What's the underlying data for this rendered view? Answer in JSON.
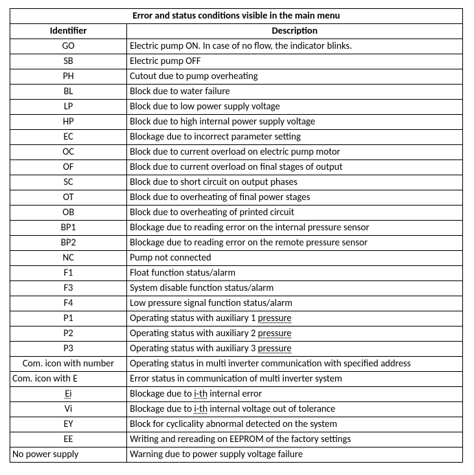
{
  "table": {
    "title": "Error and status conditions visible in the main menu",
    "headers": {
      "id": "Identifier",
      "desc": "Description"
    },
    "rows": [
      {
        "align": "center",
        "id": "GO",
        "desc": "Electric pump ON.   In case of no flow, the indicator blinks."
      },
      {
        "align": "center",
        "id": "SB",
        "desc": "Electric pump OFF"
      },
      {
        "align": "center",
        "id": "PH",
        "desc": "Cutout due to pump overheating"
      },
      {
        "align": "center",
        "id": "BL",
        "desc": "Block due to water failure"
      },
      {
        "align": "center",
        "id": "LP",
        "desc": "Block due to low power supply voltage"
      },
      {
        "align": "center",
        "id": "HP",
        "desc": "Block due to high internal power supply voltage"
      },
      {
        "align": "center",
        "id": "EC",
        "desc": "Blockage due to incorrect parameter setting"
      },
      {
        "align": "center",
        "id": "OC",
        "desc": "Block due to current overload on electric pump motor"
      },
      {
        "align": "center",
        "id": "OF",
        "desc": "Block due to current overload on final stages of output"
      },
      {
        "align": "center",
        "id": "SC",
        "desc": "Block due to short circuit on output phases"
      },
      {
        "align": "center",
        "id": "OT",
        "desc": "Block due to overheating of final power stages"
      },
      {
        "align": "center",
        "id": "OB",
        "desc": "Block due to overheating of printed circuit"
      },
      {
        "align": "center",
        "id": "BP1",
        "desc": "Blockage due to reading error on the internal pressure sensor"
      },
      {
        "align": "center",
        "id": "BP2",
        "desc": "Blockage due to reading error on the remote pressure sensor"
      },
      {
        "align": "center",
        "id": "NC",
        "desc": "Pump not connected"
      },
      {
        "align": "center",
        "id": "F1",
        "desc": "Float function status/alarm"
      },
      {
        "align": "center",
        "id": "F3",
        "desc": "System disable function status/alarm"
      },
      {
        "align": "center",
        "id": "F4",
        "desc": "Low pressure signal function status/alarm"
      },
      {
        "align": "center",
        "id": "P1",
        "desc_parts": [
          "Operating status with auxiliary 1 ",
          {
            "u": "pressure"
          }
        ]
      },
      {
        "align": "center",
        "id": "P2",
        "desc_parts": [
          "Operating status with auxiliary 2 ",
          {
            "u": "pressure"
          }
        ]
      },
      {
        "align": "center",
        "id": "P3",
        "desc_parts": [
          "Operating status with auxiliary 3 ",
          {
            "u": "pressure"
          }
        ]
      },
      {
        "align": "center",
        "id": "Com. icon with number",
        "desc": "Operating status in multi inverter communication with specified address"
      },
      {
        "align": "left",
        "id": "Com. icon with E",
        "desc": "Error status in communication of multi inverter system"
      },
      {
        "align": "center",
        "id_parts": [
          {
            "u": "Ei"
          }
        ],
        "desc_parts": [
          "Blockage due to ",
          {
            "u": "i-th"
          },
          " internal error"
        ]
      },
      {
        "align": "center",
        "id": "Vi",
        "desc_parts": [
          "Blockage due to ",
          {
            "u": "i-th"
          },
          " internal voltage out of tolerance"
        ]
      },
      {
        "align": "center",
        "id": "EY",
        "desc": "Block for cyclicality abnormal detected on the system"
      },
      {
        "align": "center",
        "id": "EE",
        "desc": "Writing and rereading on EEPROM of the factory settings"
      },
      {
        "align": "left",
        "id": "No power supply",
        "desc": "Warning due to power supply voltage failure"
      }
    ]
  }
}
